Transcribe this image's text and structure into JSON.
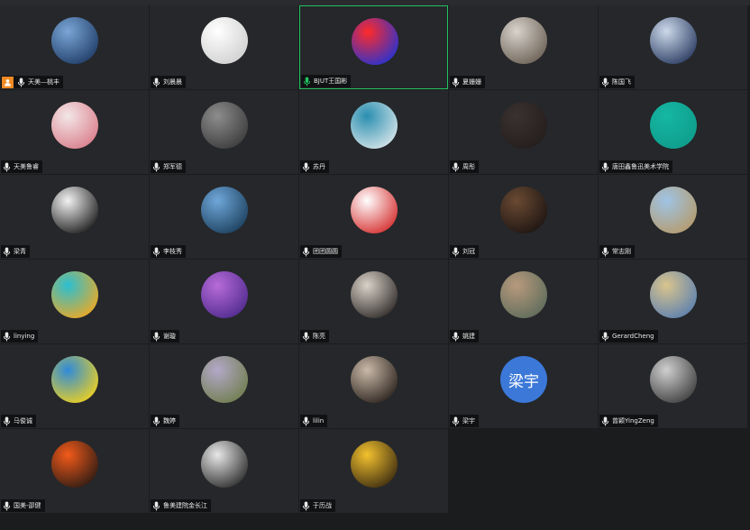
{
  "meeting": {
    "participants": [
      {
        "name": "天美—桃丰",
        "host": true,
        "speaking": false,
        "avatar_colors": [
          "#7aa6d6",
          "#1f3b66"
        ]
      },
      {
        "name": "刘晨晨",
        "host": false,
        "speaking": false,
        "avatar_colors": [
          "#ffffff",
          "#cfcfcf"
        ]
      },
      {
        "name": "BJUT王国彬",
        "host": false,
        "speaking": true,
        "active": true,
        "avatar_colors": [
          "#ff2a2a",
          "#2033d6"
        ]
      },
      {
        "name": "夏姗姗",
        "host": false,
        "speaking": false,
        "avatar_colors": [
          "#d8d3cc",
          "#6a5f54"
        ]
      },
      {
        "name": "陈国飞",
        "host": false,
        "speaking": false,
        "avatar_colors": [
          "#cdd9ea",
          "#283a60"
        ]
      },
      {
        "name": "天美鲁睿",
        "host": false,
        "speaking": false,
        "avatar_colors": [
          "#f3e7e7",
          "#d97d8a"
        ]
      },
      {
        "name": "郑军德",
        "host": false,
        "speaking": false,
        "avatar_colors": [
          "#8d8d8d",
          "#3a3a3a"
        ]
      },
      {
        "name": "苏丹",
        "host": false,
        "speaking": false,
        "avatar_colors": [
          "#2a8fb0",
          "#d9e6ea"
        ]
      },
      {
        "name": "周彤",
        "host": false,
        "speaking": false,
        "avatar_colors": [
          "#3a3230",
          "#231d1c"
        ]
      },
      {
        "name": "唐田鑫鲁迅美术学院",
        "host": false,
        "speaking": false,
        "avatar_colors": [
          "#15b7a3",
          "#0f9c8b"
        ]
      },
      {
        "name": "梁青",
        "host": false,
        "speaking": false,
        "avatar_colors": [
          "#f2f2f2",
          "#1a1a1a"
        ]
      },
      {
        "name": "李枝秀",
        "host": false,
        "speaking": false,
        "avatar_colors": [
          "#6fa7d9",
          "#1b3e5c"
        ]
      },
      {
        "name": "团团圆圆",
        "host": false,
        "speaking": false,
        "avatar_colors": [
          "#ffffff",
          "#d42b2b"
        ]
      },
      {
        "name": "刘冠",
        "host": false,
        "speaking": false,
        "avatar_colors": [
          "#6a4a33",
          "#1c1411"
        ]
      },
      {
        "name": "常志刚",
        "host": false,
        "speaking": false,
        "avatar_colors": [
          "#9fc4e6",
          "#b59a6a"
        ]
      },
      {
        "name": "linying",
        "host": false,
        "speaking": false,
        "avatar_colors": [
          "#2bbfd1",
          "#f2a81f"
        ]
      },
      {
        "name": "谢璇",
        "host": false,
        "speaking": false,
        "avatar_colors": [
          "#b76bd9",
          "#4e2a8c"
        ]
      },
      {
        "name": "陈亮",
        "host": false,
        "speaking": false,
        "avatar_colors": [
          "#d9d2c8",
          "#2e2a28"
        ]
      },
      {
        "name": "姚建",
        "host": false,
        "speaking": false,
        "avatar_colors": [
          "#b89a7d",
          "#5c6b5a"
        ]
      },
      {
        "name": "GerardCheng",
        "host": false,
        "speaking": false,
        "avatar_colors": [
          "#d9c48d",
          "#5a7fb0"
        ]
      },
      {
        "name": "马俊诚",
        "host": false,
        "speaking": false,
        "avatar_colors": [
          "#2f8bd9",
          "#f2d21b"
        ]
      },
      {
        "name": "魏婷",
        "host": false,
        "speaking": false,
        "avatar_colors": [
          "#b3a8c9",
          "#6f7d4c"
        ]
      },
      {
        "name": "lilin",
        "host": false,
        "speaking": false,
        "avatar_colors": [
          "#c9b9a8",
          "#2a211c"
        ]
      },
      {
        "name": "梁宇",
        "host": false,
        "speaking": false,
        "avatar_text": "梁宇",
        "avatar_colors": [
          "#3b78d8",
          "#3b78d8"
        ]
      },
      {
        "name": "曾颖YingZeng",
        "host": false,
        "speaking": false,
        "avatar_colors": [
          "#cfcfcf",
          "#3d3d3d"
        ]
      },
      {
        "name": "国美-邵健",
        "host": false,
        "speaking": false,
        "avatar_colors": [
          "#f25a1a",
          "#2a1a14"
        ]
      },
      {
        "name": "鲁美建院金长江",
        "host": false,
        "speaking": false,
        "avatar_colors": [
          "#e8e8e8",
          "#2a2a2a"
        ]
      },
      {
        "name": "于历战",
        "host": false,
        "speaking": false,
        "avatar_colors": [
          "#f2c12e",
          "#3a2a10"
        ]
      }
    ]
  },
  "colors": {
    "tile_bg": "#25272a",
    "page_bg": "#1b1c1e",
    "active_border": "#21c361",
    "host_badge": "#f08a24",
    "speaking_mic": "#21c361"
  }
}
